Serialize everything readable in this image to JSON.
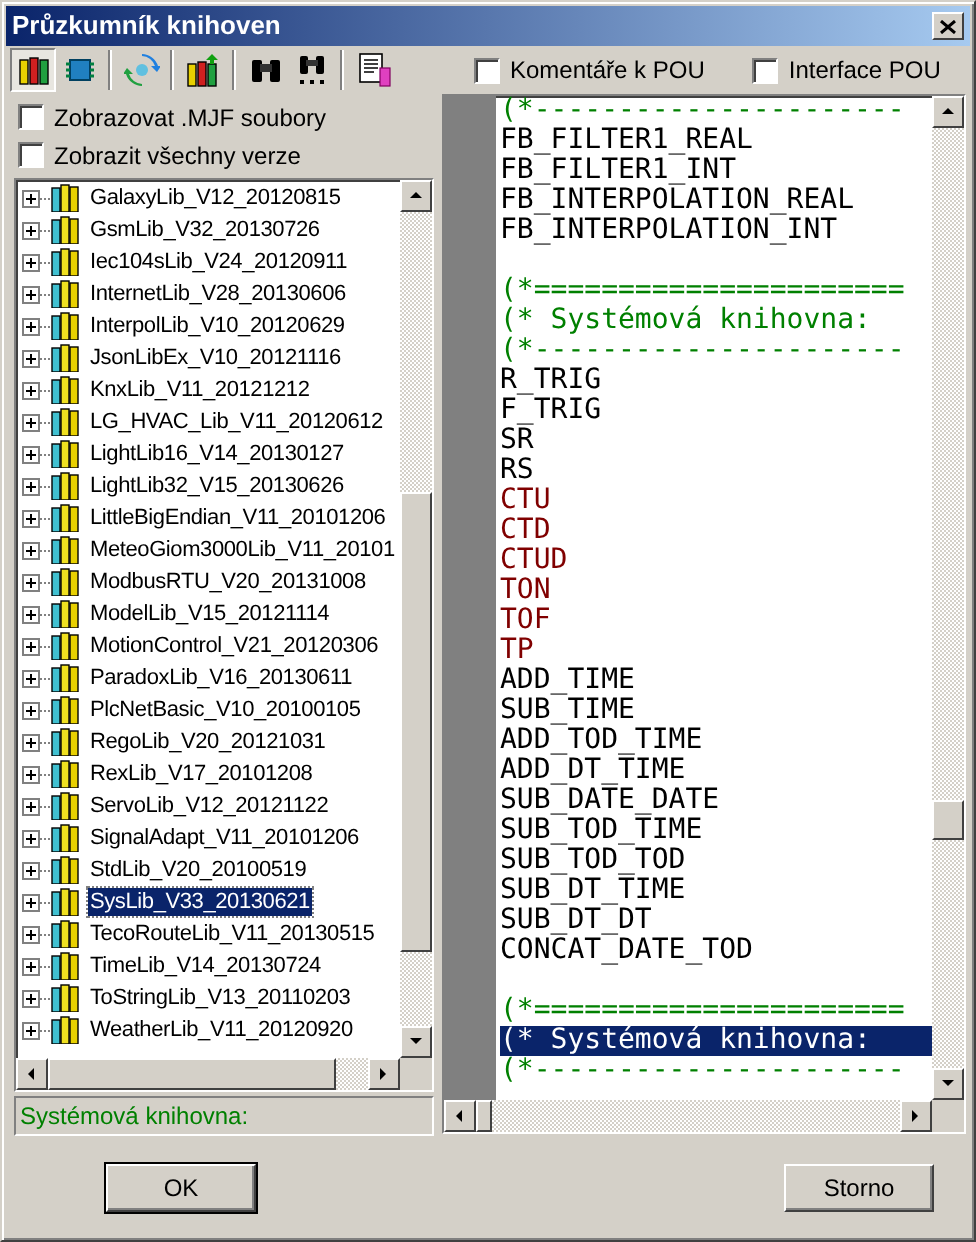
{
  "window": {
    "title": "Průzkumník knihoven"
  },
  "toolbar": [
    {
      "kind": "books",
      "pressed": true
    },
    {
      "kind": "chip",
      "pressed": false
    },
    {
      "kind": "refresh",
      "pressed": false
    },
    {
      "kind": "books-add",
      "pressed": false
    },
    {
      "kind": "binoculars",
      "pressed": false
    },
    {
      "kind": "binoculars-next",
      "pressed": false
    },
    {
      "kind": "document",
      "pressed": false
    }
  ],
  "options": [
    {
      "label": "Zobrazovat .MJF soubory",
      "checked": false
    },
    {
      "label": "Zobrazit všechny verze",
      "checked": false
    }
  ],
  "view_options": [
    {
      "label": "Komentáře k POU",
      "checked": false
    },
    {
      "label": "Interface POU",
      "checked": false
    }
  ],
  "tree": [
    {
      "label": "GalaxyLib_V12_20120815",
      "expanded": false,
      "selected": false
    },
    {
      "label": "GsmLib_V32_20130726",
      "expanded": false,
      "selected": false
    },
    {
      "label": "Iec104sLib_V24_20120911",
      "expanded": false,
      "selected": false
    },
    {
      "label": "InternetLib_V28_20130606",
      "expanded": false,
      "selected": false
    },
    {
      "label": "InterpolLib_V10_20120629",
      "expanded": false,
      "selected": false
    },
    {
      "label": "JsonLibEx_V10_20121116",
      "expanded": false,
      "selected": false
    },
    {
      "label": "KnxLib_V11_20121212",
      "expanded": false,
      "selected": false
    },
    {
      "label": "LG_HVAC_Lib_V11_20120612",
      "expanded": false,
      "selected": false
    },
    {
      "label": "LightLib16_V14_20130127",
      "expanded": false,
      "selected": false
    },
    {
      "label": "LightLib32_V15_20130626",
      "expanded": false,
      "selected": false
    },
    {
      "label": "LittleBigEndian_V11_20101206",
      "expanded": false,
      "selected": false
    },
    {
      "label": "MeteoGiom3000Lib_V11_20101",
      "expanded": false,
      "selected": false
    },
    {
      "label": "ModbusRTU_V20_20131008",
      "expanded": false,
      "selected": false
    },
    {
      "label": "ModelLib_V15_20121114",
      "expanded": false,
      "selected": false
    },
    {
      "label": "MotionControl_V21_20120306",
      "expanded": false,
      "selected": false
    },
    {
      "label": "ParadoxLib_V16_20130611",
      "expanded": false,
      "selected": false
    },
    {
      "label": "PlcNetBasic_V10_20100105",
      "expanded": false,
      "selected": false
    },
    {
      "label": "RegoLib_V20_20121031",
      "expanded": false,
      "selected": false
    },
    {
      "label": "RexLib_V17_20101208",
      "expanded": false,
      "selected": false
    },
    {
      "label": "ServoLib_V12_20121122",
      "expanded": false,
      "selected": false
    },
    {
      "label": "SignalAdapt_V11_20101206",
      "expanded": false,
      "selected": false
    },
    {
      "label": "StdLib_V20_20100519",
      "expanded": false,
      "selected": false
    },
    {
      "label": "SysLib_V33_20130621",
      "expanded": false,
      "selected": true
    },
    {
      "label": "TecoRouteLib_V11_20130515",
      "expanded": false,
      "selected": false
    },
    {
      "label": "TimeLib_V14_20130724",
      "expanded": false,
      "selected": false
    },
    {
      "label": "ToStringLib_V13_20110203",
      "expanded": false,
      "selected": false
    },
    {
      "label": "WeatherLib_V11_20120920",
      "expanded": false,
      "selected": false
    }
  ],
  "status": "Systémová knihovna:",
  "code_lines": [
    {
      "kind": "comment",
      "text": "(*----------------------",
      "selected": false
    },
    {
      "kind": "normal",
      "text": "FB_FILTER1_REAL",
      "selected": false
    },
    {
      "kind": "normal",
      "text": "FB_FILTER1_INT",
      "selected": false
    },
    {
      "kind": "normal",
      "text": "FB_INTERPOLATION_REAL",
      "selected": false
    },
    {
      "kind": "normal",
      "text": "FB_INTERPOLATION_INT",
      "selected": false
    },
    {
      "kind": "blank"
    },
    {
      "kind": "comment",
      "text": "(*======================",
      "selected": false
    },
    {
      "kind": "comment",
      "text": "(* Systémová knihovna:",
      "selected": false
    },
    {
      "kind": "comment",
      "text": "(*----------------------",
      "selected": false
    },
    {
      "kind": "normal",
      "text": "R_TRIG",
      "selected": false
    },
    {
      "kind": "normal",
      "text": "F_TRIG",
      "selected": false
    },
    {
      "kind": "normal",
      "text": "SR",
      "selected": false
    },
    {
      "kind": "normal",
      "text": "RS",
      "selected": false
    },
    {
      "kind": "block",
      "text": "CTU",
      "selected": false
    },
    {
      "kind": "block",
      "text": "CTD",
      "selected": false
    },
    {
      "kind": "block",
      "text": "CTUD",
      "selected": false
    },
    {
      "kind": "block",
      "text": "TON",
      "selected": false
    },
    {
      "kind": "block",
      "text": "TOF",
      "selected": false
    },
    {
      "kind": "block",
      "text": "TP",
      "selected": false
    },
    {
      "kind": "normal",
      "text": "ADD_TIME",
      "selected": false
    },
    {
      "kind": "normal",
      "text": "SUB_TIME",
      "selected": false
    },
    {
      "kind": "normal",
      "text": "ADD_TOD_TIME",
      "selected": false
    },
    {
      "kind": "normal",
      "text": "ADD_DT_TIME",
      "selected": false
    },
    {
      "kind": "normal",
      "text": "SUB_DATE_DATE",
      "selected": false
    },
    {
      "kind": "normal",
      "text": "SUB_TOD_TIME",
      "selected": false
    },
    {
      "kind": "normal",
      "text": "SUB_TOD_TOD",
      "selected": false
    },
    {
      "kind": "normal",
      "text": "SUB_DT_TIME",
      "selected": false
    },
    {
      "kind": "normal",
      "text": "SUB_DT_DT",
      "selected": false
    },
    {
      "kind": "normal",
      "text": "CONCAT_DATE_TOD",
      "selected": false
    },
    {
      "kind": "blank"
    },
    {
      "kind": "comment",
      "text": "(*======================",
      "selected": false
    },
    {
      "kind": "comment",
      "text": "(* Systémová knihovna:",
      "selected": true
    },
    {
      "kind": "comment",
      "text": "(*----------------------",
      "selected": false
    }
  ],
  "buttons": [
    "OK",
    "Storno"
  ]
}
